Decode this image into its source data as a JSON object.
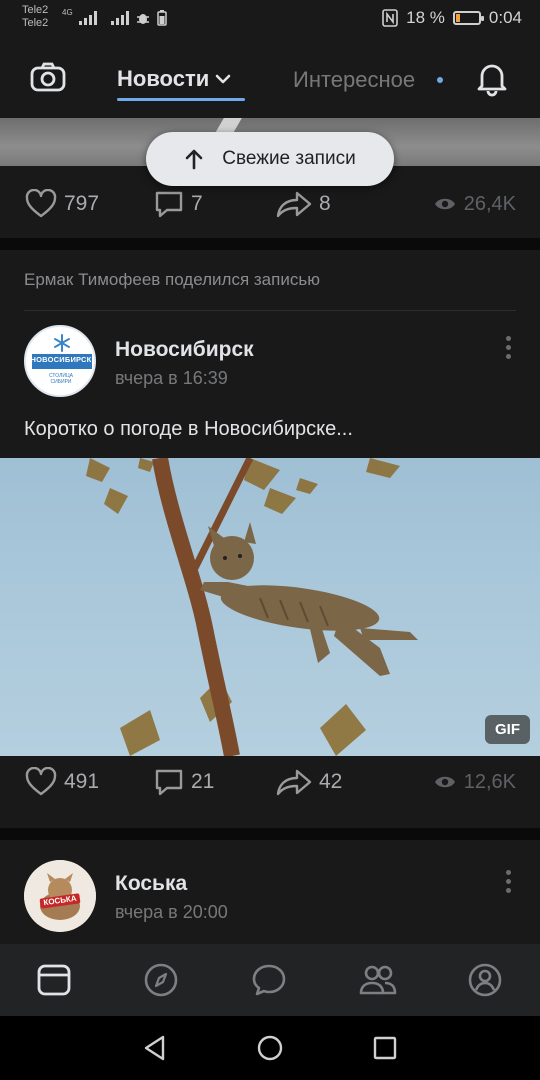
{
  "status_bar": {
    "carrier1": "Tele2",
    "carrier2": "Tele2",
    "net_badge": "4G",
    "battery_text": "18 %",
    "battery_level": 0.18,
    "time": "0:04"
  },
  "header": {
    "tab_news": "Новости",
    "tab_interesting": "Интересное"
  },
  "fresh_button": {
    "label": "Свежие записи"
  },
  "post1": {
    "likes": "797",
    "comments": "7",
    "shares": "8",
    "views": "26,4K"
  },
  "post2": {
    "shared_by": "Ермак Тимофеев поделился записью",
    "author": "Новосибирск",
    "time": "вчера в 16:39",
    "text": "Коротко о погоде в Новосибирске...",
    "avatar_title": "НОВОСИБИРСК",
    "avatar_sub1": "СТОЛИЦА",
    "avatar_sub2": "СИБИРИ",
    "gif_badge": "GIF",
    "likes": "491",
    "comments": "21",
    "shares": "42",
    "views": "12,6K"
  },
  "post3": {
    "author": "Коська",
    "time": "вчера в 20:00",
    "avatar_label": "КОСЬКА"
  },
  "colors": {
    "accent": "#71aaeb",
    "card_bg": "#19191a",
    "feed_bg": "#0a0a0a"
  }
}
